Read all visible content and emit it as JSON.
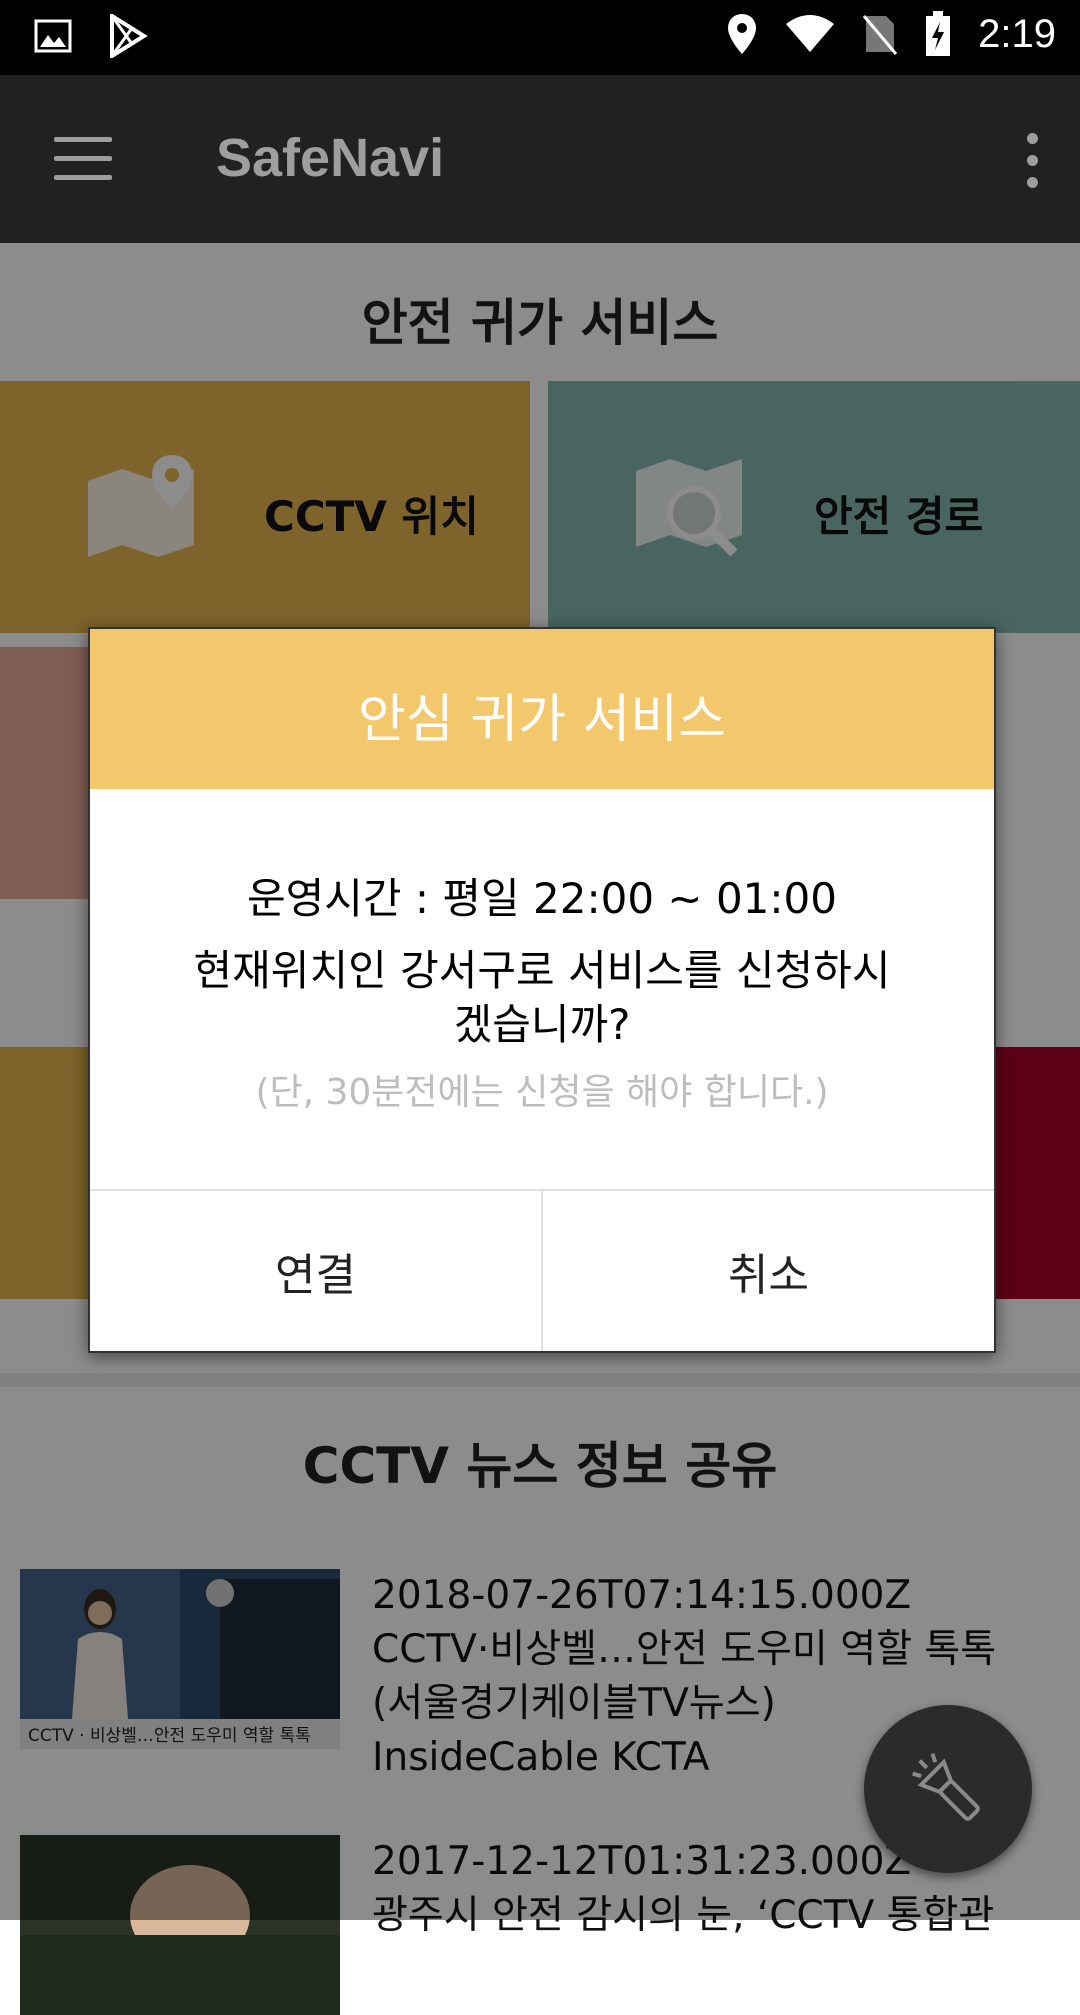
{
  "status_bar": {
    "time": "2:19"
  },
  "app_bar": {
    "title": "SafeNavi"
  },
  "main": {
    "section_title": "안전 귀가 서비스",
    "tiles": [
      {
        "label": "CCTV 위치",
        "color": "#e5b44e"
      },
      {
        "label": "안전 경로",
        "color": "#86b9b0"
      }
    ],
    "news_title": "CCTV 뉴스 정보 공유",
    "news": [
      {
        "date": "2018-07-26T07:14:15.000Z",
        "title": "CCTV·비상벨…안전 도우미 역할 톡톡 (서울경기케이블TV뉴스)",
        "source": "InsideCable KCTA",
        "thumb_caption": "CCTV · 비상벨…안전 도우미 역할 톡톡"
      },
      {
        "date": "2017-12-12T01:31:23.000Z",
        "title": "광주시 안전 감시의 눈, ‘CCTV 통합관"
      }
    ]
  },
  "dialog": {
    "title": "안심 귀가 서비스",
    "line1": "운영시간 : 평일 22:00 ~ 01:00",
    "line2": "현재위치인 강서구로 서비스를 신청하시",
    "line3": "겠습니까?",
    "note": "(단, 30분전에는 신청을 해야 합니다.)",
    "confirm_label": "연결",
    "cancel_label": "취소",
    "header_color": "#f3c76b"
  },
  "fab": {
    "icon": "flashlight-icon"
  }
}
